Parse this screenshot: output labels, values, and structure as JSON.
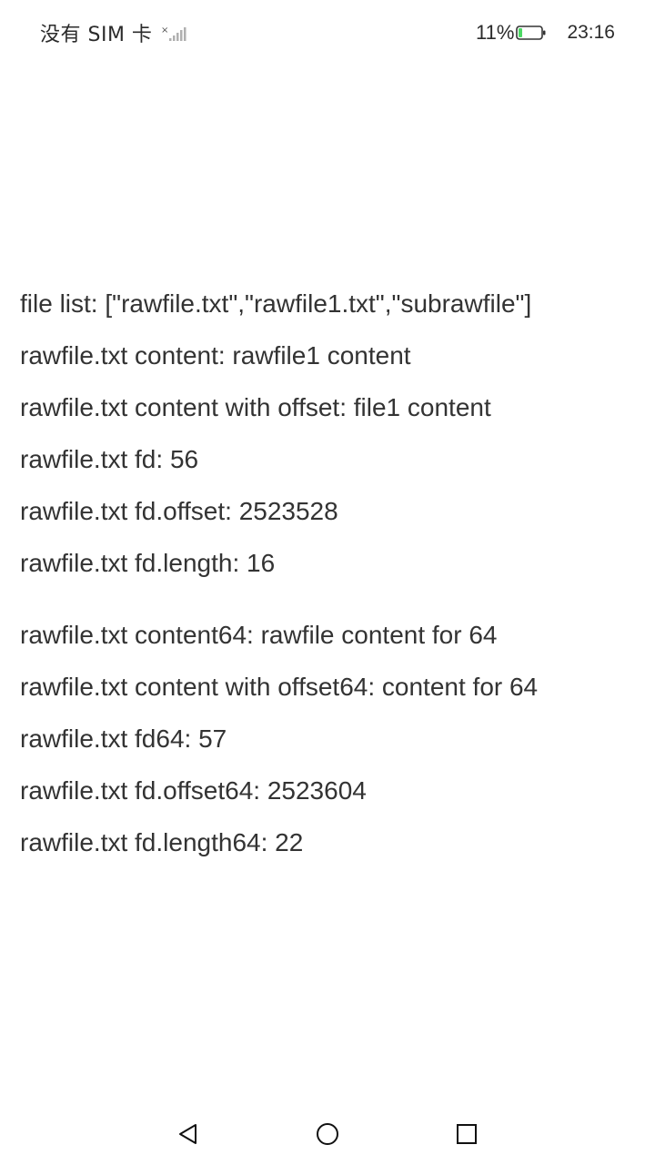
{
  "status_bar": {
    "carrier": "没有 SIM 卡",
    "signal_icon": "signal-no-sim-icon",
    "battery_percent": "11%",
    "battery_icon": "battery-low-icon",
    "time": "23:16"
  },
  "content": {
    "group1": [
      "file list: [\"rawfile.txt\",\"rawfile1.txt\",\"subrawfile\"]",
      "rawfile.txt content: rawfile1 content",
      "rawfile.txt content with offset: file1 content",
      "rawfile.txt fd: 56",
      "rawfile.txt fd.offset: 2523528",
      "rawfile.txt fd.length: 16"
    ],
    "group2": [
      "rawfile.txt content64: rawfile content for 64",
      "rawfile.txt content with offset64: content for 64",
      "rawfile.txt fd64: 57",
      "rawfile.txt fd.offset64: 2523604",
      "rawfile.txt fd.length64: 22"
    ]
  },
  "nav_bar": {
    "back_icon": "back-triangle-icon",
    "home_icon": "home-circle-icon",
    "recent_icon": "recent-apps-square-icon"
  },
  "colors": {
    "text": "#333333",
    "background": "#ffffff",
    "battery_fill": "#4cd964"
  }
}
